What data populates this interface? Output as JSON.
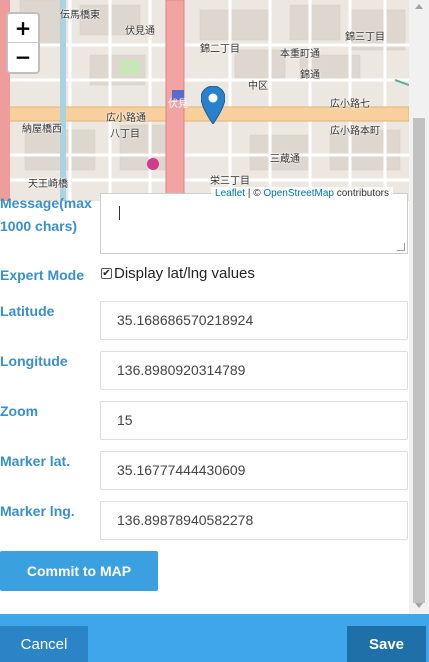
{
  "map": {
    "zoom_in": "+",
    "zoom_out": "−",
    "attribution_link1": "Leaflet",
    "attribution_sep": " | © ",
    "attribution_link2": "OpenStreetMap",
    "attribution_tail": " contributors",
    "labels": [
      "伝馬橋東",
      "伏見通",
      "錦二丁目",
      "中区",
      "伏見",
      "広小路通",
      "広小路七",
      "錦通",
      "広小路本町",
      "栄三丁目",
      "天王崎橋",
      "納屋橋西",
      "八丁目",
      "本重町通",
      "錦三丁目",
      "三蔵通"
    ]
  },
  "form": {
    "message_label": "Message(max 1000 chars)",
    "expert_label": "Expert Mode",
    "expert_checkbox_text": "Display lat/lng values",
    "expert_checked": "✔",
    "latitude_label": "Latitude",
    "latitude_value": "35.168686570218924",
    "longitude_label": "Longitude",
    "longitude_value": "136.8980920314789",
    "zoom_label": "Zoom",
    "zoom_value": "15",
    "marker_lat_label": "Marker lat.",
    "marker_lat_value": "35.16777444430609",
    "marker_lng_label": "Marker lng.",
    "marker_lng_value": "136.89878940582278",
    "commit_label": "Commit to MAP"
  },
  "footer": {
    "cancel_label": "Cancel",
    "save_label": "Save"
  },
  "colors": {
    "accent": "#3aa0e0",
    "footer": "#3fa6ec",
    "save": "#1f6fa8",
    "label": "#3a8fc8"
  }
}
